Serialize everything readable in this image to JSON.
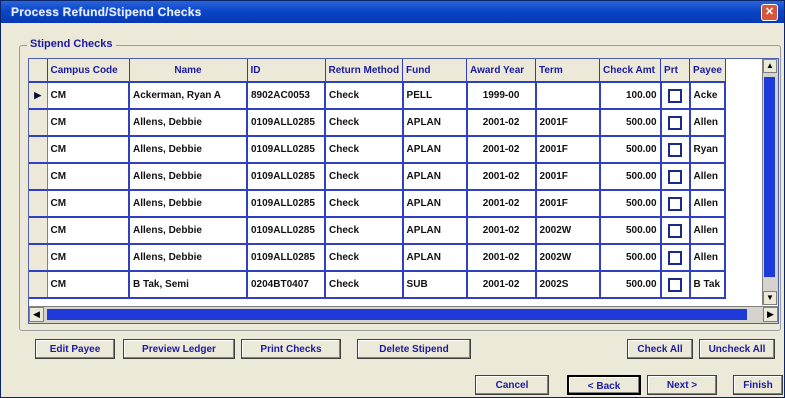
{
  "window": {
    "title": "Process Refund/Stipend Checks"
  },
  "group": {
    "label": "Stipend Checks"
  },
  "grid": {
    "columns": [
      "Campus Code",
      "Name",
      "ID",
      "Return Method",
      "Fund",
      "Award Year",
      "Term",
      "Check Amt",
      "Prt",
      "Payee"
    ],
    "rows": [
      {
        "current": true,
        "cells": [
          "CM",
          "Ackerman, Ryan A",
          "8902AC0053",
          "Check",
          "PELL",
          "1999-00",
          "",
          "100.00",
          "",
          "Acke"
        ]
      },
      {
        "current": false,
        "cells": [
          "CM",
          "Allens, Debbie",
          "0109ALL0285",
          "Check",
          "APLAN",
          "2001-02",
          "2001F",
          "500.00",
          "",
          "Allen"
        ]
      },
      {
        "current": false,
        "cells": [
          "CM",
          "Allens, Debbie",
          "0109ALL0285",
          "Check",
          "APLAN",
          "2001-02",
          "2001F",
          "500.00",
          "",
          "Ryan"
        ]
      },
      {
        "current": false,
        "cells": [
          "CM",
          "Allens, Debbie",
          "0109ALL0285",
          "Check",
          "APLAN",
          "2001-02",
          "2001F",
          "500.00",
          "",
          "Allen"
        ]
      },
      {
        "current": false,
        "cells": [
          "CM",
          "Allens, Debbie",
          "0109ALL0285",
          "Check",
          "APLAN",
          "2001-02",
          "2001F",
          "500.00",
          "",
          "Allen"
        ]
      },
      {
        "current": false,
        "cells": [
          "CM",
          "Allens, Debbie",
          "0109ALL0285",
          "Check",
          "APLAN",
          "2001-02",
          "2002W",
          "500.00",
          "",
          "Allen"
        ]
      },
      {
        "current": false,
        "cells": [
          "CM",
          "Allens, Debbie",
          "0109ALL0285",
          "Check",
          "APLAN",
          "2001-02",
          "2002W",
          "500.00",
          "",
          "Allen"
        ]
      },
      {
        "current": false,
        "cells": [
          "CM",
          "B Tak, Semi",
          "0204BT0407",
          "Check",
          "SUB",
          "2001-02",
          "2002S",
          "500.00",
          "",
          "B Tak"
        ]
      }
    ]
  },
  "buttons": {
    "edit_payee": "Edit Payee",
    "preview_ledger": "Preview Ledger",
    "print_checks": "Print Checks",
    "delete_stipend": "Delete Stipend",
    "check_all": "Check All",
    "uncheck_all": "Uncheck All",
    "cancel": "Cancel",
    "back": "< Back",
    "next": "Next >",
    "finish": "Finish"
  },
  "icons": {
    "close": "close-icon",
    "row_pointer": "row-pointer-icon"
  },
  "colors": {
    "titlebar": "#0a46c8",
    "grid_lines": "#3040c0",
    "header_text": "#1a1aa0",
    "scroll_thumb": "#1e3bd8"
  }
}
